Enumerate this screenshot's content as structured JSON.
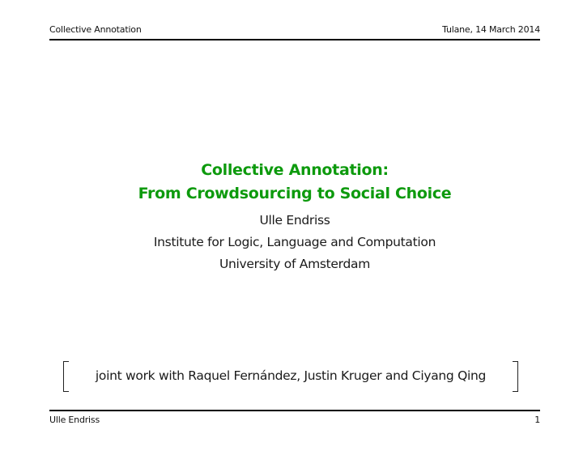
{
  "header": {
    "left": "Collective Annotation",
    "right": "Tulane, 14 March 2014"
  },
  "title": {
    "line1": "Collective Annotation:",
    "line2": "From Crowdsourcing to Social Choice"
  },
  "authors": {
    "name": "Ulle Endriss",
    "institute": "Institute for Logic, Language and Computation",
    "university": "University of Amsterdam"
  },
  "joint_work": "joint work with Raquel Fernández, Justin Kruger and Ciyang Qing",
  "footer": {
    "left": "Ulle Endriss",
    "page_number": "1"
  },
  "colors": {
    "title": "#0d9a0d",
    "text": "#1a1a1a",
    "rule": "#000000"
  }
}
